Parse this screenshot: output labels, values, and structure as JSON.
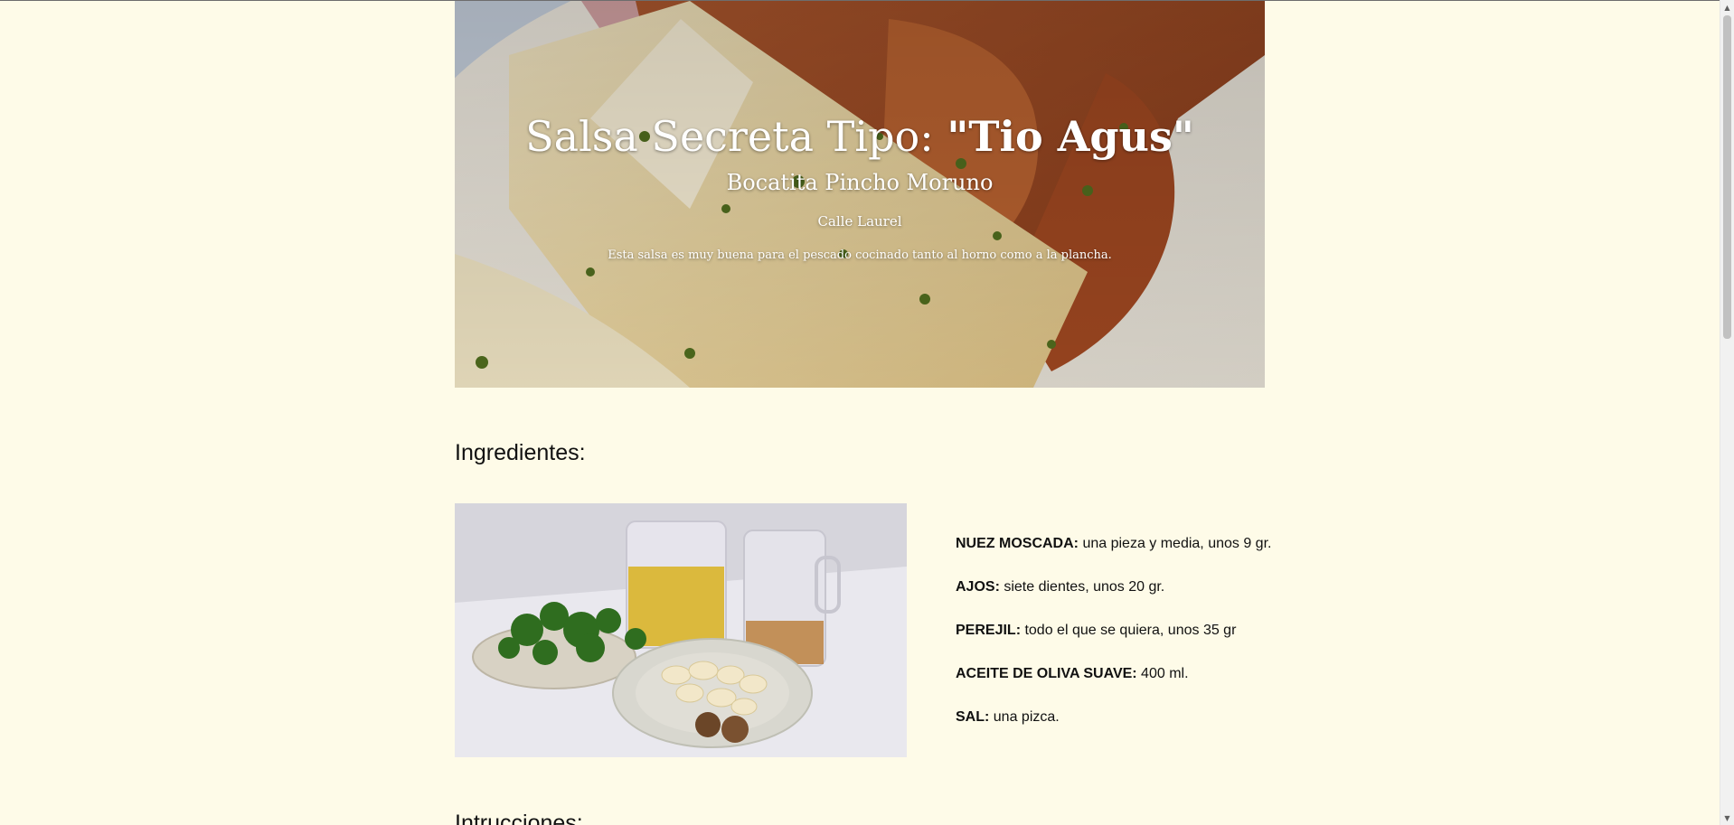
{
  "hero": {
    "title_prefix": "Salsa Secreta Tipo: ",
    "title_highlight": "\"Tio Agus\"",
    "subtitle": "Bocatita Pincho Moruno",
    "street": "Calle Laurel",
    "description": "Esta salsa es muy buena para el pescado cocinado tanto al horno como a la plancha."
  },
  "ingredients": {
    "heading": "Ingredientes:",
    "items": [
      {
        "name": "NUEZ MOSCADA:",
        "detail": " una pieza y media, unos 9 gr."
      },
      {
        "name": "AJOS:",
        "detail": " siete dientes, unos 20 gr."
      },
      {
        "name": "PEREJIL:",
        "detail": " todo el que se quiera, unos 35 gr"
      },
      {
        "name": "ACEITE DE OLIVA SUAVE:",
        "detail": " 400 ml."
      },
      {
        "name": "SAL:",
        "detail": " una pizca."
      }
    ]
  },
  "instructions": {
    "heading": "Intrucciones:"
  },
  "colors": {
    "page_background": "#fefbe8",
    "text": "#111111",
    "hero_text": "#ffffff"
  }
}
